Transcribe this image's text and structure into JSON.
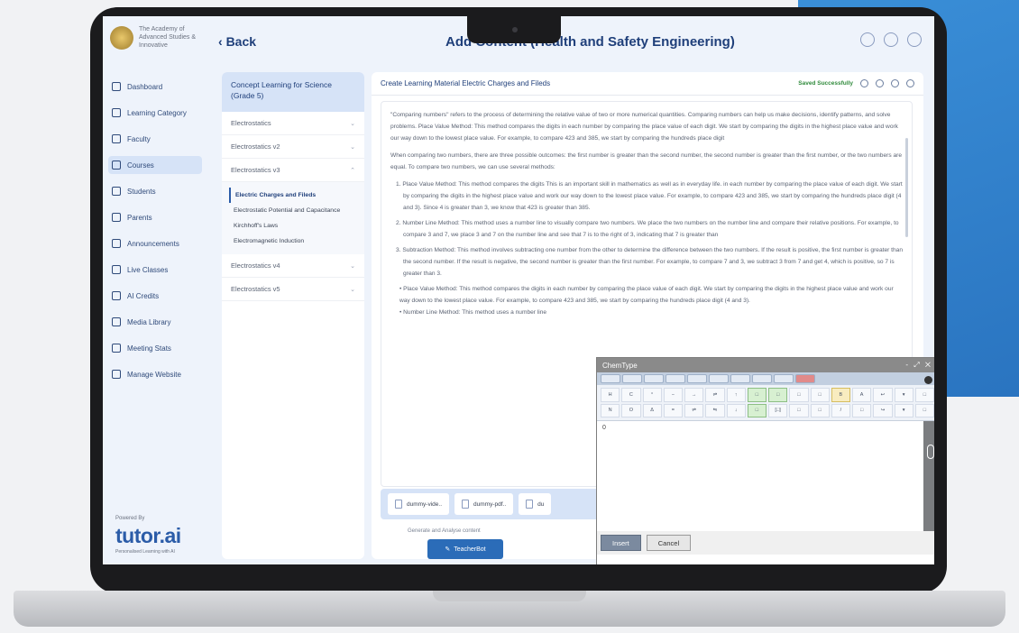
{
  "colors": {
    "accent": "#2b5ca8",
    "saved": "#2f8a3b"
  },
  "org": {
    "name": "The Academy of Advanced Studies & Innovative"
  },
  "sidebar": {
    "items": [
      {
        "label": "Dashboard"
      },
      {
        "label": "Learning Category"
      },
      {
        "label": "Faculty"
      },
      {
        "label": "Courses"
      },
      {
        "label": "Students"
      },
      {
        "label": "Parents"
      },
      {
        "label": "Announcements"
      },
      {
        "label": "Live Classes"
      },
      {
        "label": "AI Credits"
      },
      {
        "label": "Media Library"
      },
      {
        "label": "Meeting Stats"
      },
      {
        "label": "Manage Website"
      }
    ],
    "powered_by": "Powered By",
    "brand": "tutor.ai",
    "tagline": "Personalised Learning with AI"
  },
  "header": {
    "back_label": "Back",
    "title": "Add Content (Health and Safety Engineering)"
  },
  "chapters": {
    "heading": "Concept Learning for Science (Grade 5)",
    "items": [
      {
        "label": "Electrostatics"
      },
      {
        "label": "Electrostatics v2"
      },
      {
        "label": "Electrostatics v3"
      },
      {
        "label": "Electrostatics v4"
      },
      {
        "label": "Electrostatics v5"
      }
    ],
    "sub_items": [
      {
        "label": "Electric Charges and Fileds"
      },
      {
        "label": "Electrostatic Potential and Capacitance"
      },
      {
        "label": "Kirchhoff's Laws"
      },
      {
        "label": "Electromagnetic Induction"
      }
    ]
  },
  "content": {
    "title": "Create Learning Material Electric Charges and Fileds",
    "status": "Saved Successfully",
    "para1": "\"Comparing numbers\" refers to the process of determining the relative value of two or more numerical quantities. Comparing numbers can help us make decisions, identify patterns, and solve problems. Place Value Method: This method compares the digits in each number by comparing the place value of each digit. We start by comparing the digits in the highest place value and work our way down to the lowest place value. For example, to compare 423 and 385, we start by comparing the hundreds place digit",
    "para2": "When comparing two numbers, there are three possible outcomes: the first number is greater than the second number, the second number is greater than the first number, or the two numbers are equal. To compare two numbers, we can use several methods:",
    "list": [
      "1. Place Value Method: This method compares the digits This is an important skill in mathematics as well as in everyday life. in each number by comparing the place value of each digit. We start by comparing the digits in the highest place value and work our way down to the lowest place value. For example, to compare 423 and 385, we start by comparing the hundreds place digit (4 and 3). Since 4 is greater than 3, we know that 423 is greater than 385.",
      "2. Number Line Method: This method uses a number line to visually compare two numbers. We place the two numbers on the number line and compare their relative positions. For example, to compare 3 and 7, we place 3 and 7 on the number line and see that 7 is to the right of 3, indicating that 7 is greater than",
      "3. Subtraction Method: This method involves subtracting one number from the other to determine the difference between the two numbers. If the result is positive, the first number is greater than the second number. If the result is negative, the second number is greater than the first number. For example, to compare 7 and 3, we subtract 3 from 7 and get 4, which is positive, so 7 is greater than 3."
    ],
    "bullets": [
      "Place Value Method: This method compares the digits in each number by comparing the place value of each digit. We start by comparing the digits in the highest place value and work our way down to the lowest place value. For example, to compare 423 and 385, we start by comparing the hundreds place digit (4 and 3).",
      "Number Line Method: This method uses a number line"
    ],
    "attachments": [
      {
        "label": "dummy-vide.."
      },
      {
        "label": "dummy-pdf.."
      },
      {
        "label": "du"
      }
    ],
    "generate_label": "Generate and Analyse content",
    "teacherbot_label": "TeacherBot"
  },
  "chemtype": {
    "title": "ChemType",
    "insert_label": "Insert",
    "cancel_label": "Cancel",
    "editor_value": "0"
  }
}
